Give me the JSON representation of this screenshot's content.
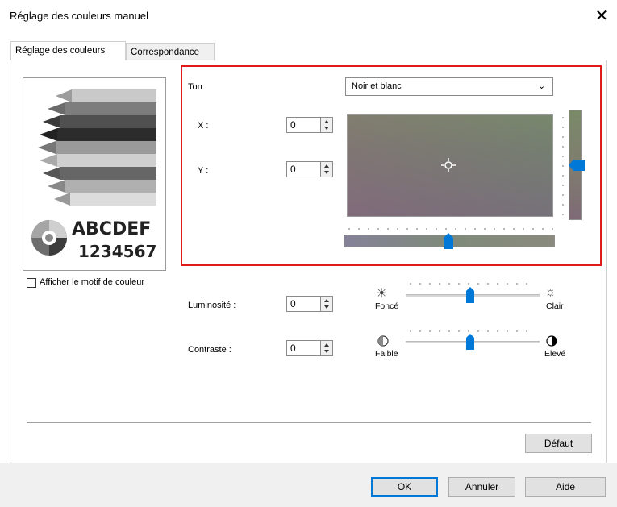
{
  "window": {
    "title": "Réglage des couleurs manuel"
  },
  "tabs": [
    {
      "label": "Réglage des couleurs",
      "active": true
    },
    {
      "label": "Correspondance",
      "active": false
    }
  ],
  "preview": {
    "text_line1": "ABCDEF",
    "text_line2": "1234567"
  },
  "show_pattern": {
    "label": "Afficher le motif de couleur",
    "checked": false
  },
  "tone": {
    "label": "Ton :",
    "selected": "Noir et blanc",
    "x_label": "X :",
    "x_value": "0",
    "y_label": "Y :",
    "y_value": "0"
  },
  "brightness": {
    "label": "Luminosité :",
    "value": "0",
    "low_label": "Foncé",
    "high_label": "Clair"
  },
  "contrast": {
    "label": "Contraste :",
    "value": "0",
    "low_label": "Faible",
    "high_label": "Elevé"
  },
  "buttons": {
    "default": "Défaut",
    "ok": "OK",
    "cancel": "Annuler",
    "help": "Aide"
  },
  "colors": {
    "accent": "#0078d7",
    "highlight": "#e01a1a"
  }
}
